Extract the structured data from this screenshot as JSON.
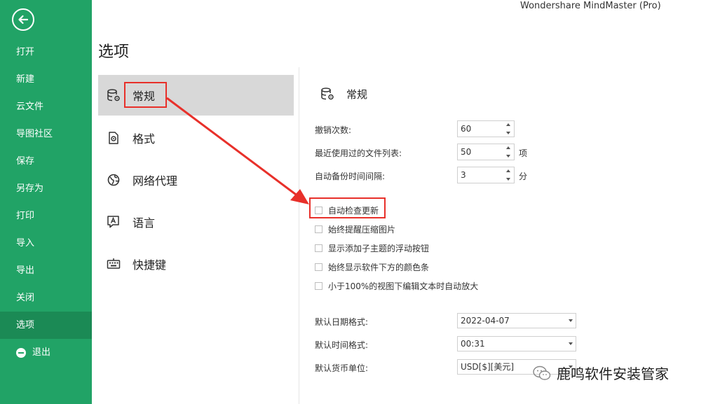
{
  "app_title": "Wondershare MindMaster (Pro)",
  "page_title": "选项",
  "sidebar": {
    "back_icon": "back-arrow-icon",
    "items": [
      {
        "label": "打开"
      },
      {
        "label": "新建"
      },
      {
        "label": "云文件"
      },
      {
        "label": "导图社区"
      },
      {
        "label": "保存"
      },
      {
        "label": "另存为"
      },
      {
        "label": "打印"
      },
      {
        "label": "导入"
      },
      {
        "label": "导出"
      },
      {
        "label": "关闭"
      },
      {
        "label": "选项",
        "active": true
      },
      {
        "label": "退出",
        "icon": "minus-circle-icon"
      }
    ]
  },
  "categories": [
    {
      "label": "常规",
      "icon": "database-gear-icon",
      "active": true
    },
    {
      "label": "格式",
      "icon": "format-gear-icon"
    },
    {
      "label": "网络代理",
      "icon": "globe-icon"
    },
    {
      "label": "语言",
      "icon": "language-icon"
    },
    {
      "label": "快捷键",
      "icon": "keyboard-icon"
    }
  ],
  "section": {
    "title": "常规",
    "icon": "database-gear-icon",
    "spin_rows": [
      {
        "label": "撤销次数:",
        "value": "60",
        "unit": ""
      },
      {
        "label": "最近使用过的文件列表:",
        "value": "50",
        "unit": "项"
      },
      {
        "label": "自动备份时间间隔:",
        "value": "3",
        "unit": "分"
      }
    ],
    "checkboxes": [
      {
        "label": "自动检查更新",
        "checked": false
      },
      {
        "label": "始终提醒压缩图片",
        "checked": false
      },
      {
        "label": "显示添加子主题的浮动按钮",
        "checked": false
      },
      {
        "label": "始终显示软件下方的颜色条",
        "checked": false
      },
      {
        "label": "小于100%的视图下编辑文本时自动放大",
        "checked": false
      }
    ],
    "selects": [
      {
        "label": "默认日期格式:",
        "value": "2022-04-07"
      },
      {
        "label": "默认时间格式:",
        "value": "00:31"
      },
      {
        "label": "默认货币单位:",
        "value": "USD[$][美元]"
      }
    ]
  },
  "watermark": {
    "caption": "鹿鸣软件安装管家",
    "icon": "wechat-icon"
  },
  "colors": {
    "sidebar_green": "#21a366",
    "sidebar_active": "#1b8a55",
    "annotation_red": "#e8302a",
    "category_active_bg": "#d8d8d8"
  }
}
